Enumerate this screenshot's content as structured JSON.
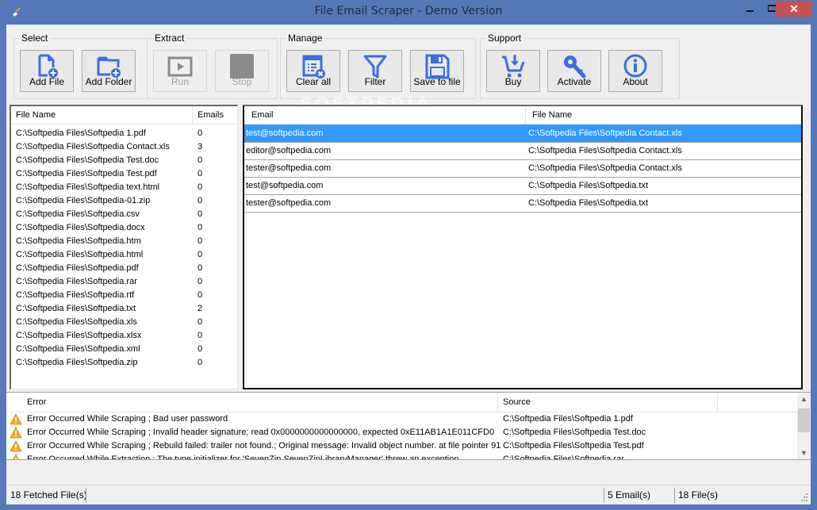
{
  "window": {
    "title": "File Email Scraper - Demo Version",
    "controls": {
      "minimize": "–",
      "maximize": "□",
      "close": "✕"
    }
  },
  "toolbar": {
    "groups": [
      {
        "label": "Select",
        "buttons": [
          {
            "label": "Add File",
            "icon": "add-file-icon",
            "enabled": true
          },
          {
            "label": "Add Folder",
            "icon": "add-folder-icon",
            "enabled": true
          }
        ]
      },
      {
        "label": "Extract",
        "buttons": [
          {
            "label": "Run",
            "icon": "play-icon",
            "enabled": false
          },
          {
            "label": "Stop",
            "icon": "stop-icon",
            "enabled": false
          }
        ]
      },
      {
        "label": "Manage",
        "buttons": [
          {
            "label": "Clear all",
            "icon": "clear-list-icon",
            "enabled": true
          },
          {
            "label": "Filter",
            "icon": "filter-icon",
            "enabled": true
          },
          {
            "label": "Save to file",
            "icon": "save-icon",
            "enabled": true
          }
        ]
      },
      {
        "label": "Support",
        "buttons": [
          {
            "label": "Buy",
            "icon": "cart-icon",
            "enabled": true
          },
          {
            "label": "Activate",
            "icon": "key-icon",
            "enabled": true
          },
          {
            "label": "About",
            "icon": "info-icon",
            "enabled": true
          }
        ]
      }
    ]
  },
  "accent_color": "#3a6fe0",
  "files_list": {
    "columns": [
      "File Name",
      "Emails"
    ],
    "rows": [
      {
        "name": "C:\\Softpedia Files\\Softpedia 1.pdf",
        "emails": "0"
      },
      {
        "name": "C:\\Softpedia Files\\Softpedia Contact.xls",
        "emails": "3"
      },
      {
        "name": "C:\\Softpedia Files\\Softpedia Test.doc",
        "emails": "0"
      },
      {
        "name": "C:\\Softpedia Files\\Softpedia Test.pdf",
        "emails": "0"
      },
      {
        "name": "C:\\Softpedia Files\\Softpedia text.html",
        "emails": "0"
      },
      {
        "name": "C:\\Softpedia Files\\Softpedia-01.zip",
        "emails": "0"
      },
      {
        "name": "C:\\Softpedia Files\\Softpedia.csv",
        "emails": "0"
      },
      {
        "name": "C:\\Softpedia Files\\Softpedia.docx",
        "emails": "0"
      },
      {
        "name": "C:\\Softpedia Files\\Softpedia.htm",
        "emails": "0"
      },
      {
        "name": "C:\\Softpedia Files\\Softpedia.html",
        "emails": "0"
      },
      {
        "name": "C:\\Softpedia Files\\Softpedia.pdf",
        "emails": "0"
      },
      {
        "name": "C:\\Softpedia Files\\Softpedia.rar",
        "emails": "0"
      },
      {
        "name": "C:\\Softpedia Files\\Softpedia.rtf",
        "emails": "0"
      },
      {
        "name": "C:\\Softpedia Files\\Softpedia.txt",
        "emails": "2"
      },
      {
        "name": "C:\\Softpedia Files\\Softpedia.xls",
        "emails": "0"
      },
      {
        "name": "C:\\Softpedia Files\\Softpedia.xlsx",
        "emails": "0"
      },
      {
        "name": "C:\\Softpedia Files\\Softpedia.xml",
        "emails": "0"
      },
      {
        "name": "C:\\Softpedia Files\\Softpedia.zip",
        "emails": "0"
      }
    ]
  },
  "emails_grid": {
    "columns": [
      "Email",
      "File Name"
    ],
    "selected_index": 0,
    "rows": [
      {
        "email": "test@softpedia.com",
        "file": "C:\\Softpedia Files\\Softpedia Contact.xls"
      },
      {
        "email": "editor@softpedia.com",
        "file": "C:\\Softpedia Files\\Softpedia Contact.xls"
      },
      {
        "email": "tester@softpedia.com",
        "file": "C:\\Softpedia Files\\Softpedia Contact.xls"
      },
      {
        "email": "test@softpedia.com",
        "file": "C:\\Softpedia Files\\Softpedia.txt"
      },
      {
        "email": "tester@softpedia.com",
        "file": "C:\\Softpedia Files\\Softpedia.txt"
      }
    ]
  },
  "errors_list": {
    "columns": [
      "Error",
      "Source"
    ],
    "rows": [
      {
        "error": "Error Occurred While Scraping ; Bad user password",
        "source": "C:\\Softpedia Files\\Softpedia 1.pdf"
      },
      {
        "error": "Error Occurred While Scraping ; Invalid header signature; read 0x0000000000000000, expected 0xE11AB1A1E011CFD0",
        "source": "C:\\Softpedia Files\\Softpedia Test.doc"
      },
      {
        "error": "Error Occurred While Scraping ; Rebuild failed: trailer not found.; Original message: Invalid object number. at file pointer 91",
        "source": "C:\\Softpedia Files\\Softpedia Test.pdf"
      },
      {
        "error": "Error Occurred While Extraction ; The type initializer for 'SevenZip.SevenZipLibraryManager' threw an exception.",
        "source": "C:\\Softpedia Files\\Softpedia.rar"
      }
    ]
  },
  "statusbar": {
    "fetched": "18 Fetched File(s)",
    "emails": "5 Email(s)",
    "files": "18 File(s)"
  },
  "watermark": "SOFTPEDIA"
}
